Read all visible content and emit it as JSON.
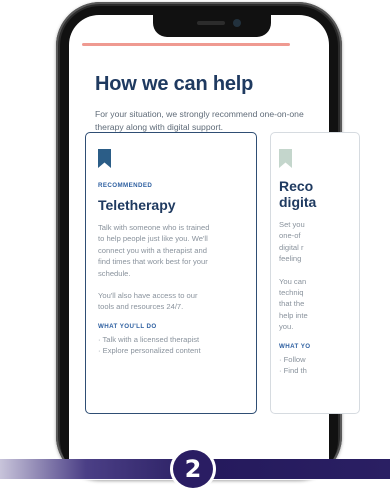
{
  "page": {
    "title": "How we can help",
    "intro": "For your situation, we strongly recommend one-on-one therapy along with digital support."
  },
  "cards": [
    {
      "icon": "bookmark-icon",
      "icon_color": "#2b5d87",
      "eyebrow": "RECOMMENDED",
      "title": "Teletherapy",
      "body_1": "Talk with someone who is trained\nto help people just like you. We'll\nconnect you with a therapist and\nfind times that work best for your\nschedule.",
      "body_2": "You'll also have access to our\ntools and resources 24/7.",
      "list_label": "WHAT YOU'LL DO",
      "list": [
        "· Talk with a licensed therapist",
        "· Explore personalized content"
      ]
    },
    {
      "icon": "bookmark-icon",
      "icon_color": "#c4d6cc",
      "eyebrow": "",
      "title": "Reco\ndigita",
      "body_1": "Set you\none-of\ndigital r\nfeeling",
      "body_2": "You can\ntechniq\nthat the\nhelp inte\nyou.",
      "list_label": "WHAT YO",
      "list": [
        "· Follow",
        "· Find th"
      ]
    }
  ],
  "step": {
    "number": "2"
  },
  "colors": {
    "title": "#1f3a60",
    "accent_bar": "#ef9a91",
    "eyebrow": "#2d5fa0",
    "badge": "#2a1d63"
  }
}
